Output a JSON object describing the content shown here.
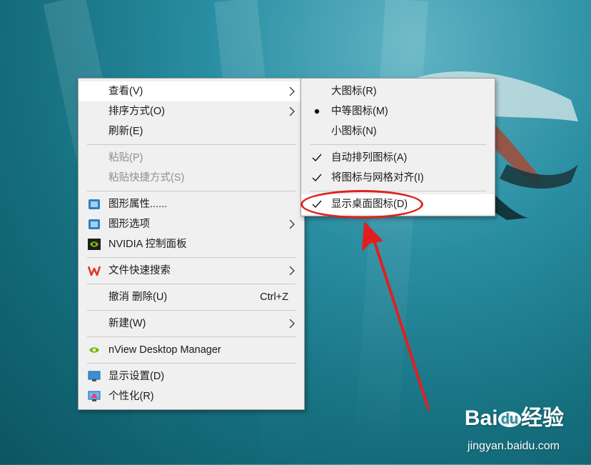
{
  "context_menu": {
    "items": [
      {
        "label": "查看(V)",
        "has_submenu": true,
        "state": "active"
      },
      {
        "label": "排序方式(O)",
        "has_submenu": true
      },
      {
        "label": "刷新(E)"
      },
      {
        "label": "粘贴(P)",
        "disabled": true
      },
      {
        "label": "粘贴快捷方式(S)",
        "disabled": true
      },
      {
        "label": "图形属性......",
        "icon": "intel-graphics-icon"
      },
      {
        "label": "图形选项",
        "icon": "intel-graphics-icon",
        "has_submenu": true
      },
      {
        "label": "NVIDIA 控制面板",
        "icon": "nvidia-icon"
      },
      {
        "label": "文件快速搜索",
        "icon": "wps-icon",
        "has_submenu": true
      },
      {
        "label": "撤消 删除(U)",
        "shortcut": "Ctrl+Z"
      },
      {
        "label": "新建(W)",
        "has_submenu": true
      },
      {
        "label": "nView Desktop Manager",
        "icon": "nvidia-icon"
      },
      {
        "label": "显示设置(D)",
        "icon": "display-settings-icon"
      },
      {
        "label": "个性化(R)",
        "icon": "personalize-icon"
      }
    ]
  },
  "view_submenu": {
    "items": [
      {
        "label": "大图标(R)"
      },
      {
        "label": "中等图标(M)",
        "selected": true
      },
      {
        "label": "小图标(N)"
      },
      {
        "label": "自动排列图标(A)",
        "checked": true
      },
      {
        "label": "将图标与网格对齐(I)",
        "checked": true
      },
      {
        "label": "显示桌面图标(D)",
        "checked": true,
        "highlighted": true
      }
    ]
  },
  "annotation": {
    "color": "#e02020",
    "target": "显示桌面图标(D)"
  },
  "watermark": {
    "brand_left": "Bai",
    "brand_mid": "du",
    "brand_right": "经验",
    "url": "jingyan.baidu.com"
  }
}
